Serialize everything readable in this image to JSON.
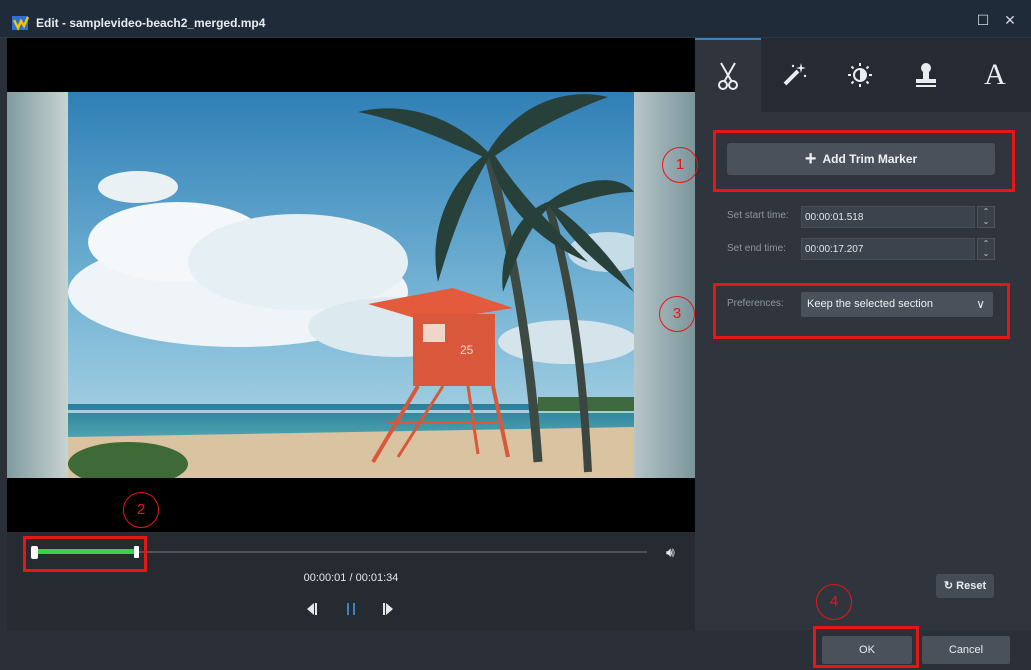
{
  "window": {
    "title": "Edit - samplevideo-beach2_merged.mp4",
    "maximize_symbol": "☐",
    "close_symbol": "✕"
  },
  "video": {
    "lifeguard_number": "25"
  },
  "playback": {
    "progress": 0.17,
    "timecode": "00:00:01 / 00:01:34"
  },
  "tabs": [
    {
      "icon": "scissors-icon",
      "active": true
    },
    {
      "icon": "magic-wand-icon",
      "active": false
    },
    {
      "icon": "brightness-icon",
      "active": false
    },
    {
      "icon": "stamp-icon",
      "active": false
    },
    {
      "icon": "text-icon",
      "glyph": "A",
      "active": false
    }
  ],
  "trim": {
    "add_trim_label": "Add Trim Marker",
    "start_label": "Set start time:",
    "start_value": "00:00:01.518",
    "end_label": "Set end time:",
    "end_value": "00:00:17.207",
    "preferences_label": "Preferences:",
    "preferences_value": "Keep the selected section",
    "reset_label": "Reset"
  },
  "footer": {
    "ok_label": "OK",
    "cancel_label": "Cancel"
  },
  "annotations": [
    "1",
    "2",
    "3",
    "4"
  ],
  "colors": {
    "accent_red": "#e51616",
    "progress_green": "#3bd14a",
    "active_tab_blue": "#3a82c4"
  }
}
